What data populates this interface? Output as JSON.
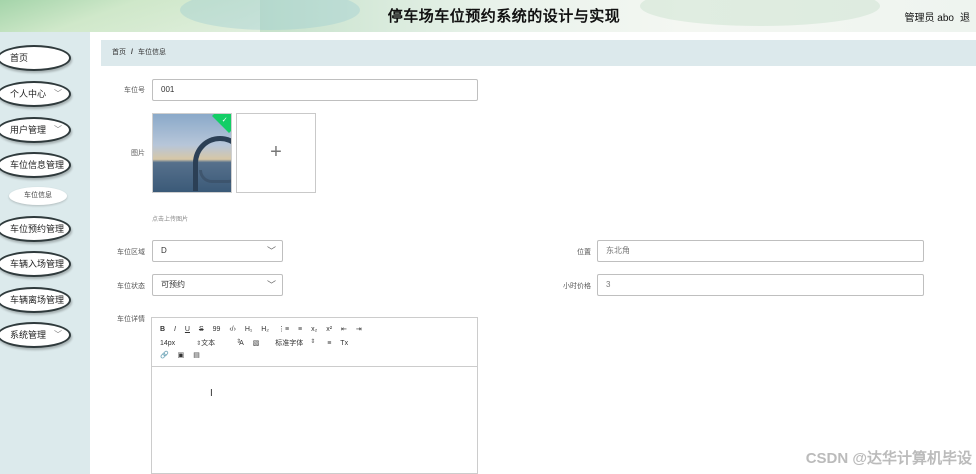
{
  "header": {
    "title": "停车场车位预约系统的设计与实现",
    "user_role": "管理员 abo",
    "logout_label": "退"
  },
  "sidebar": {
    "items": [
      {
        "label": "首页",
        "has_arrow": false
      },
      {
        "label": "个人中心",
        "has_arrow": true
      },
      {
        "label": "用户管理",
        "has_arrow": true
      },
      {
        "label": "车位信息管理",
        "has_arrow": false
      },
      {
        "label": "车位预约管理",
        "has_arrow": false
      },
      {
        "label": "车辆入场管理",
        "has_arrow": false
      },
      {
        "label": "车辆离场管理",
        "has_arrow": false
      },
      {
        "label": "系统管理",
        "has_arrow": true
      }
    ],
    "submenu": {
      "label": "车位信息"
    },
    "chevron_icon": "chevron-down-icon"
  },
  "breadcrumb": {
    "home": "首页",
    "separator": "/",
    "current": "车位信息"
  },
  "form": {
    "spot_no": {
      "label": "车位号",
      "value": "001"
    },
    "image": {
      "label": "图片",
      "hint": "点击上传图片",
      "add_icon": "+",
      "check_icon": "✓"
    },
    "area": {
      "label": "车位区域",
      "value": "D"
    },
    "location": {
      "label": "位置",
      "value": "东北角"
    },
    "status": {
      "label": "车位状态",
      "value": "可预约"
    },
    "hourly_price": {
      "label": "小时价格",
      "value": "3"
    },
    "details": {
      "label": "车位详情"
    }
  },
  "editor": {
    "row1": [
      "B",
      "I",
      "U",
      "S",
      "99",
      "‹/›",
      "H₁",
      "H₂",
      "⋮≡",
      "≡",
      "x₂",
      "x²",
      "⇤",
      "⇥"
    ],
    "row2": {
      "size": "14px",
      "type": "文本",
      "font": "标准字体"
    },
    "row2_icons": [
      "A",
      "▧",
      "≡",
      "Tx"
    ],
    "row3": [
      "🔗",
      "▣",
      "▤"
    ],
    "cursor": "I"
  },
  "watermark": "CSDN @达华计算机毕设",
  "colors": {
    "sidebar_bg": "#dceaec",
    "breadcrumb_bg": "#dce9ec",
    "upload_success": "#13ce66"
  }
}
